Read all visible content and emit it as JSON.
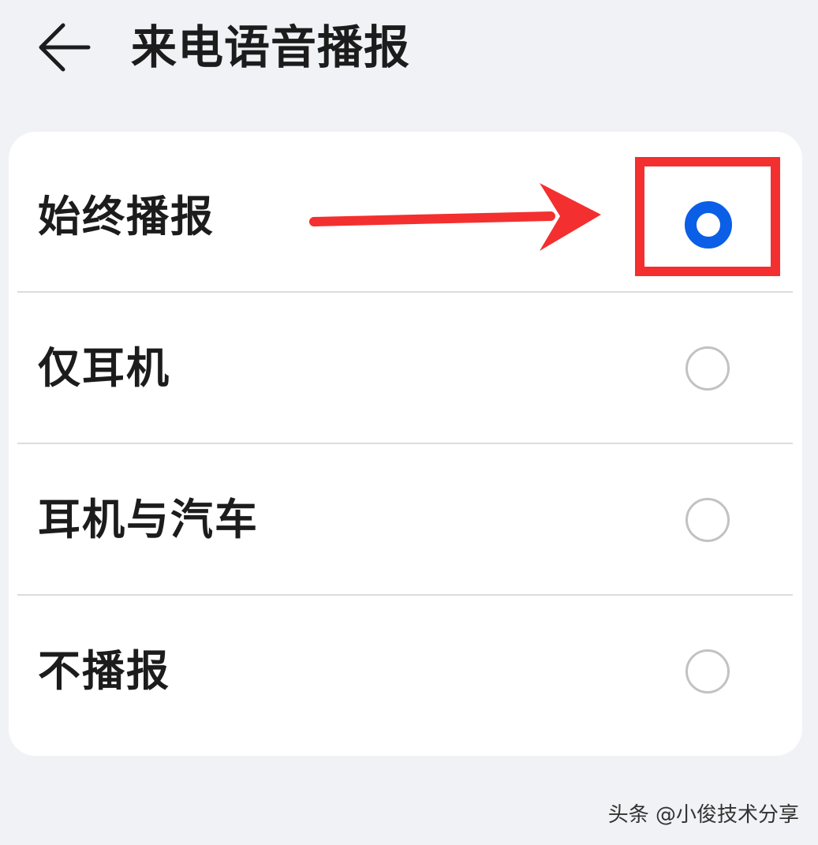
{
  "header": {
    "title": "来电语音播报",
    "back_icon": "arrow-left-icon"
  },
  "options": [
    {
      "label": "始终播报",
      "selected": true
    },
    {
      "label": "仅耳机",
      "selected": false
    },
    {
      "label": "耳机与汽车",
      "selected": false
    },
    {
      "label": "不播报",
      "selected": false
    }
  ],
  "annotation": {
    "arrow_color": "#f3302f",
    "box_color": "#f3302f"
  },
  "colors": {
    "accent": "#0a5fe6",
    "background": "#f1f2f6",
    "card": "#ffffff"
  },
  "watermark": "头条 @小俊技术分享"
}
